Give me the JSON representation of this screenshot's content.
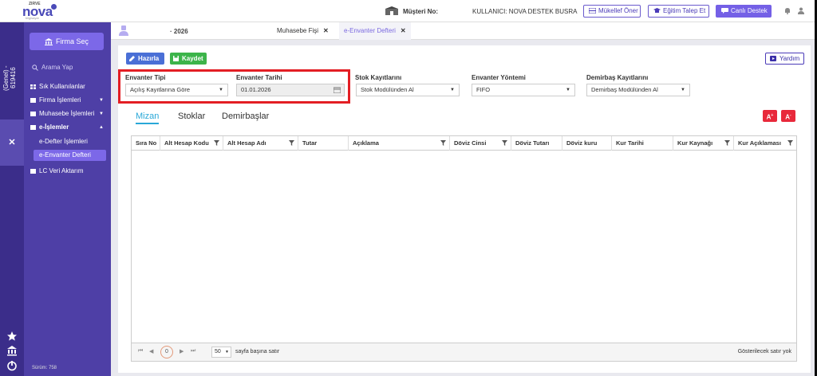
{
  "header": {
    "logo_brand": "ZIRVE",
    "logo_name": "nova",
    "logo_tag": "bilgisayar",
    "customer_label": "Müşteri No:",
    "user_label": "KULLANICI: NOVA DESTEK BUSRA",
    "buttons": [
      "Mükellef Öner",
      "Eğitim Talep Et",
      "Canlı Destek"
    ]
  },
  "rail": {
    "vertical_text": "(Genel) - 619416",
    "close_symbol": "✕"
  },
  "sidebar": {
    "firma_button": "Firma Seç",
    "search_placeholder": "Arama Yap",
    "items": [
      {
        "label": "Sık Kullanılanlar"
      },
      {
        "label": "Firma İşlemleri",
        "caret": "▼"
      },
      {
        "label": "Muhasebe İşlemleri",
        "caret": "▼"
      },
      {
        "label": "e-İşlemler",
        "caret": "▲"
      },
      {
        "label": "LC Veri Aktarım"
      }
    ],
    "subitems": [
      "e-Defter İşlemleri",
      "e-Envanter Defteri"
    ],
    "version": "Sürüm: 758"
  },
  "tabs": {
    "year": "· 2026",
    "items": [
      {
        "label": "Muhasebe Fişi",
        "close": "✕"
      },
      {
        "label": "e-Envanter Defteri",
        "close": "✕"
      }
    ]
  },
  "toolbar": {
    "prepare_label": "Hazırla",
    "save_label": "Kaydet",
    "help_label": "Yardım"
  },
  "form": {
    "envanter_tipi": {
      "label": "Envanter Tipi",
      "value": "Açılış Kayıtlarına Göre"
    },
    "envanter_tarihi": {
      "label": "Envanter Tarihi",
      "value": "01.01.2026"
    },
    "stok_kayitlari": {
      "label": "Stok Kayıtlarını",
      "value": "Stok Modülünden Al"
    },
    "envanter_yontemi": {
      "label": "Envanter Yöntemi",
      "value": "FIFO"
    },
    "demirbas_kayitlari": {
      "label": "Demirbaş Kayıtlarını",
      "value": "Demirbaş Modülünden Al"
    },
    "select_arrow": "▼"
  },
  "subtabs": [
    "Mizan",
    "Stoklar",
    "Demirbaşlar"
  ],
  "font_buttons": {
    "increase": "A",
    "decrease": "A",
    "plus": "+",
    "minus": "-"
  },
  "grid": {
    "columns": [
      "Sıra No",
      "Alt Hesap Kodu",
      "Alt Hesap Adı",
      "Tutar",
      "Açıklama",
      "Döviz Cinsi",
      "Döviz Tutarı",
      "Döviz kuru",
      "Kur Tarihi",
      "Kur Kaynağı",
      "Kur Açıklaması"
    ],
    "page_first": "⏮",
    "page_prev": "◀",
    "current_page": "0",
    "page_next": "▶",
    "page_last": "⏭",
    "page_size": "50",
    "page_size_label": "sayfa başına satır",
    "empty_text": "Gösterilecek satır yok"
  },
  "colors": {
    "accent": "#7460e6",
    "sidebar": "#4e3fa6",
    "rail": "#3b2d8a",
    "green": "#3cb44a",
    "red_highlight": "#e31e24",
    "active_tab": "#29a8d8"
  }
}
